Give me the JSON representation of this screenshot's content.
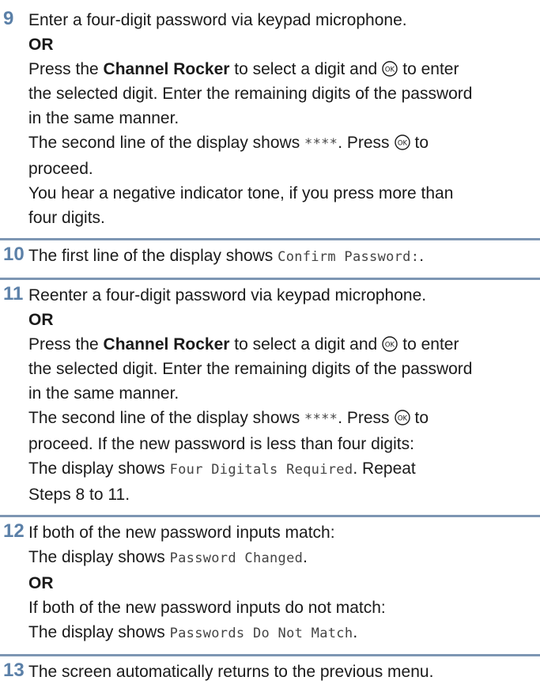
{
  "steps": {
    "s9": {
      "number": "9",
      "line1": "Enter a four-digit password via keypad microphone.",
      "or": "OR",
      "p1_pre": "Press the ",
      "p1_bold": "Channel Rocker",
      "p1_mid": " to select a digit and",
      "p1_post": "to enter",
      "line_b": "the selected digit. Enter the remaining digits of the password",
      "line_c": "in the same manner.",
      "second_pre": "The second line of the display shows ",
      "second_mono": "****",
      "second_post": ". Press",
      "to": "to",
      "proceed": "proceed.",
      "neg1": "You hear a negative indicator tone, if you press more than",
      "neg2": "four digits."
    },
    "s10": {
      "number": "10",
      "pre": "The first line of the display shows ",
      "mono": "Confirm Password:",
      "post": "."
    },
    "s11": {
      "number": "11",
      "line1": "Reenter a four-digit password via keypad microphone.",
      "or": "OR",
      "p1_pre": "Press the ",
      "p1_bold": "Channel Rocker",
      "p1_mid": " to select a digit and",
      "p1_post": "to enter",
      "line_b": "the selected digit. Enter the remaining digits of the password",
      "line_c": "in the same manner.",
      "second_pre": "The second line of the display shows ",
      "second_mono": "****",
      "second_post": ". Press",
      "to": "to",
      "proceed": "proceed. If the new password is less than four digits:",
      "disp_pre": "The display shows ",
      "disp_mono": "Four Digitals Required",
      "disp_post": ". Repeat",
      "repeat": "Steps 8 to 11."
    },
    "s12": {
      "number": "12",
      "line1": "If both of the new password inputs match:",
      "line2_pre": "The display shows ",
      "line2_mono": "Password Changed",
      "line2_post": ".",
      "or": "OR",
      "line3": "If both of the new password inputs do not match:",
      "line4_pre": "The display shows ",
      "line4_mono": "Passwords Do Not Match",
      "line4_post": "."
    },
    "s13": {
      "number": "13",
      "line1": "The screen automatically returns to the previous menu."
    }
  },
  "icons": {
    "ok_button": "ok-button-icon"
  },
  "colors": {
    "step_number": "#5b80a8",
    "divider": "#7d96b3"
  }
}
